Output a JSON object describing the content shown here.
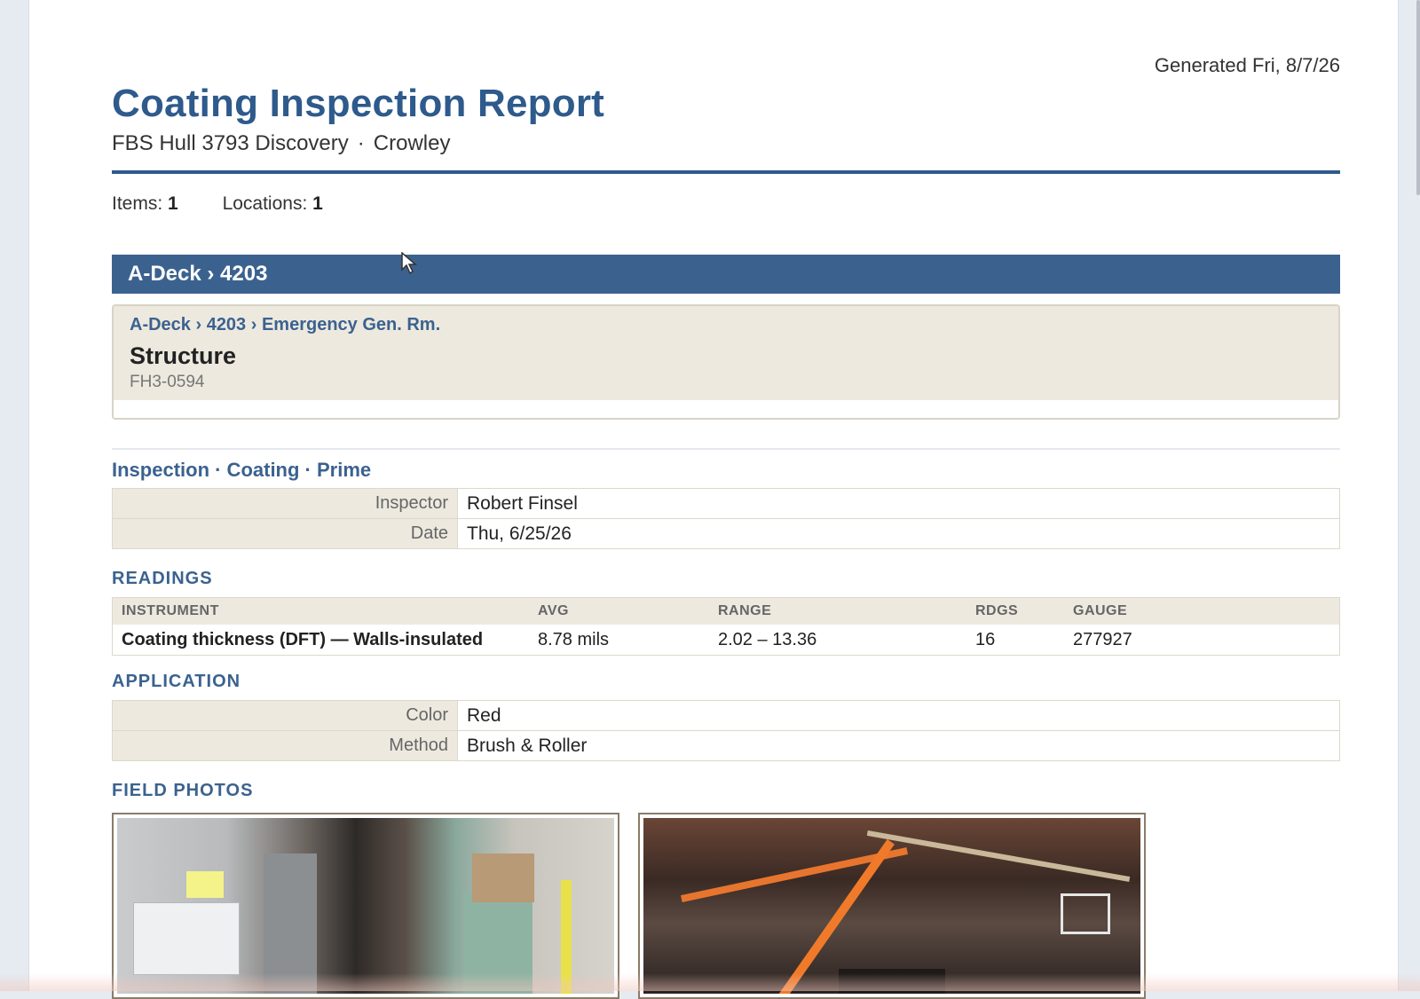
{
  "report": {
    "generated": "Generated Fri, 8/7/26",
    "title": "Coating Inspection Report",
    "vessel": "FBS Hull 3793 Discovery",
    "separator": "·",
    "owner": "Crowley"
  },
  "stats": {
    "items_label": "Items:",
    "items_value": "1",
    "locations_label": "Locations:",
    "locations_value": "1"
  },
  "location": {
    "header": "A-Deck › 4203"
  },
  "item": {
    "breadcrumb": "A-Deck › 4203 › Emergency Gen. Rm.",
    "title": "Structure",
    "code": "FH3-0594"
  },
  "inspection": {
    "title": "Inspection · Coating · Prime",
    "fields": [
      {
        "label": "Inspector",
        "value": "Robert Finsel"
      },
      {
        "label": "Date",
        "value": "Thu, 6/25/26"
      }
    ]
  },
  "readings": {
    "section_label": "READINGS",
    "columns": [
      "INSTRUMENT",
      "AVG",
      "RANGE",
      "RDGS",
      "GAUGE"
    ],
    "rows": [
      {
        "instrument": "Coating thickness (DFT) — Walls-insulated",
        "avg": "8.78 mils",
        "range": "2.02 – 13.36",
        "rdgs": "16",
        "gauge": "277927"
      }
    ]
  },
  "application": {
    "section_label": "APPLICATION",
    "fields": [
      {
        "label": "Color",
        "value": "Red"
      },
      {
        "label": "Method",
        "value": "Brush & Roller"
      }
    ]
  },
  "photos": {
    "section_label": "FIELD PHOTOS"
  },
  "colors": {
    "accent": "#2e5a8c",
    "location_bar": "#3b628f",
    "card_bg": "#ede9df"
  }
}
